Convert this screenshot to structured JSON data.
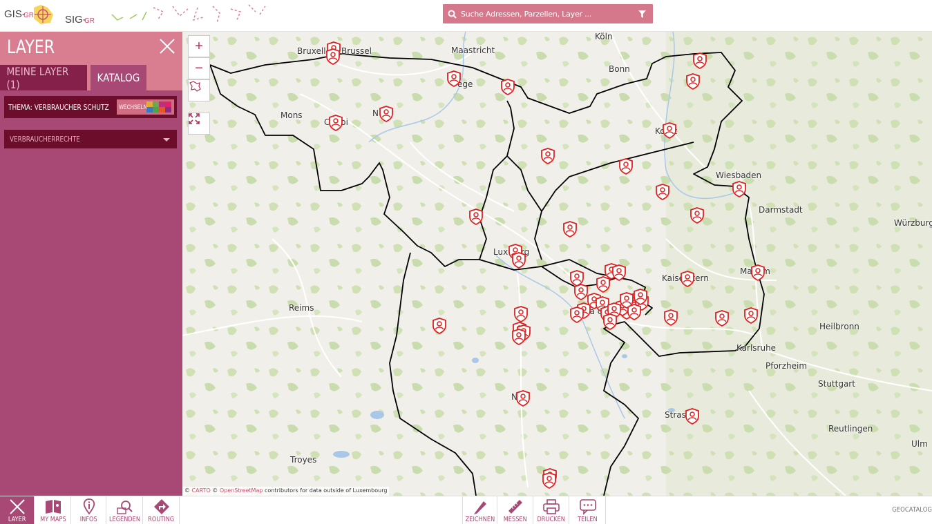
{
  "header": {
    "logo_left": "GIS-GR",
    "logo_right": "SIG-GR",
    "search_placeholder": "Suche Adressen, Parzellen, Layer ..."
  },
  "panel": {
    "title": "LAYER",
    "tabs": [
      {
        "label": "MEINE LAYER (1)",
        "active": false
      },
      {
        "label": "KATALOG",
        "active": true
      }
    ],
    "theme_label": "THEMA: VERBRAUCHER SCHUTZ",
    "switch_label": "WECHSELN",
    "switch_colors": [
      "#e4a93b",
      "#6aa84f",
      "#c0307a",
      "#e1206e",
      "#3a7bbf",
      "#51a04a",
      "#e45826",
      "#8a2c8a"
    ],
    "category": "VERBRAUCHERRECHTE"
  },
  "map": {
    "attribution_carto": "CARTO",
    "attribution_osm": "OpenStreetMap",
    "attribution_rest": "contributors for data outside of Luxembourg",
    "cities": [
      "Köln",
      "Bonn",
      "Maastricht",
      "Bruxelles",
      "Brussel",
      "Liège",
      "Mons",
      "Charleroi",
      "Namur",
      "Koblenz",
      "Wiesbaden",
      "Darmstadt",
      "Würzburg",
      "Luxembourg",
      "Kaiserslautern",
      "Mannheim",
      "Reims",
      "Saarbrücken",
      "Heilbronn",
      "Karlsruhe",
      "Pforzheim",
      "Stuttgart",
      "Nancy",
      "Strasbourg",
      "Reutlingen",
      "Ulm",
      "Troyes"
    ],
    "city_labels": {
      "koln": "Köln",
      "bonn": "Bonn",
      "maastricht": "Maastricht",
      "bruxelles": "Bruxell",
      "brussel": "Brussel",
      "liege": "ège",
      "mons": "Mons",
      "charleroi": "C   eroi",
      "namur": "N   ur",
      "koblenz": "Ko   nz",
      "wiesbaden": "Wiesbaden",
      "darmstadt": "Darmstadt",
      "wurzburg": "Würzburg",
      "luxembourg": "Lux      ourg",
      "kaiserslautern": "Kaise   utern",
      "mannheim": "Ma    eim",
      "reims": "Reims",
      "saarbrucken": "Sa   cke",
      "heilbronn": "Heilbronn",
      "karlsruhe": "Karlsruhe",
      "pforzheim": "Pforzheim",
      "stuttgart": "Stuttgart",
      "nancy": "N   y",
      "strasbourg": "Stras   rg",
      "reutlingen": "Reutlingen",
      "ulm": "Ulm",
      "troyes": "Troyes"
    },
    "controls": {
      "zoom_in": "+",
      "zoom_out": "−"
    }
  },
  "bottom": {
    "left_buttons": [
      "LAYER",
      "MY MAPS",
      "INFOS",
      "LEGENDEN",
      "ROUTING"
    ],
    "center_buttons": [
      "ZEICHNEN",
      "MESSEN",
      "DRUCKEN",
      "TEILEN"
    ],
    "right_label": "GEOCATALOG"
  },
  "colors": {
    "accent": "#a84874",
    "header_pink": "#d97d90",
    "dark_maroon": "#6b0d2b",
    "marker_red": "#e0201f",
    "border": "#000000"
  }
}
